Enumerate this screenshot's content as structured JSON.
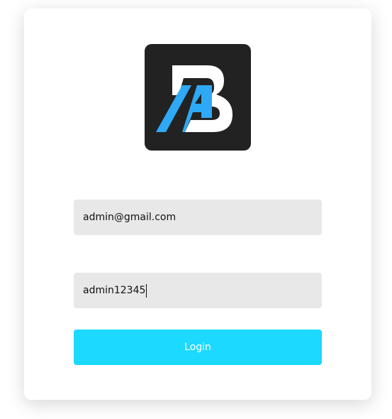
{
  "logo": {
    "icon": "ab-monogram-logo",
    "background_color": "#222222",
    "letter_a_color": "#2ea9f5",
    "letter_b_color": "#ffffff"
  },
  "form": {
    "email_value": "admin@gmail.com",
    "password_value": "admin12345",
    "login_label": "Login",
    "button_color": "#1cd9ff"
  }
}
